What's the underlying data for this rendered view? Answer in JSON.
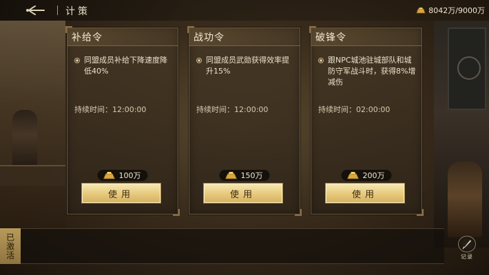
{
  "header": {
    "title": "计策",
    "resource": {
      "icon": "gold-ingot-icon",
      "value": "8042万/9000万"
    }
  },
  "cards": [
    {
      "title": "补给令",
      "description": "同盟成员补给下降速度降低40%",
      "duration": "持续时间：12:00:00",
      "cost": "100万",
      "button": "使用"
    },
    {
      "title": "战功令",
      "description": "同盟成员武勋获得效率提升15%",
      "duration": "持续时间：12:00:00",
      "cost": "150万",
      "button": "使用"
    },
    {
      "title": "破锋令",
      "description": "跟NPC城池驻城部队和城防守军战斗时，获得8%增减伤",
      "duration": "持续时间：02:00:00",
      "cost": "200万",
      "button": "使用"
    }
  ],
  "bottom": {
    "activated_tab": "已激活",
    "record_label": "记录"
  },
  "colors": {
    "gold_button": "#e6c97c",
    "card_bg": "#46382a",
    "accent_text": "#f4ead4"
  }
}
